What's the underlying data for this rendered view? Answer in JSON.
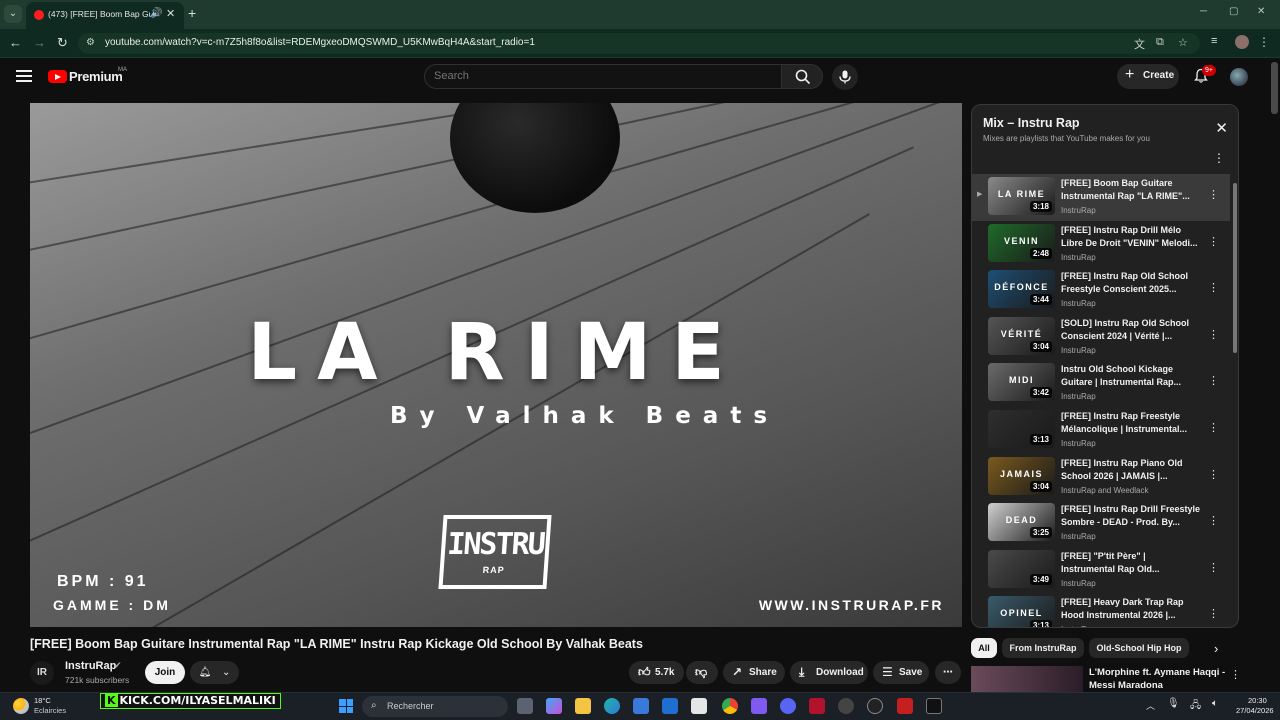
{
  "browser": {
    "tab_title": "(473) [FREE] Boom Bap Guit",
    "url": "youtube.com/watch?v=c-m7Z5h8f8o&list=RDEMgxeoDMQSWMD_U5KMwBqH4A&start_radio=1"
  },
  "header": {
    "brand": "Premium",
    "country": "MA",
    "search_placeholder": "Search",
    "create_label": "Create",
    "notification_count": "9+"
  },
  "video": {
    "overlay_title": "LA RIME",
    "overlay_subtitle": "By Valhak Beats",
    "logo_text": "INSTRU",
    "logo_sub": "RAP",
    "bpm": "BPM : 91",
    "gamme": "GAMME : DM",
    "website": "WWW.INSTRURAP.FR",
    "title": "[FREE] Boom Bap Guitare Instrumental Rap \"LA RIME\" Instru Rap Kickage Old School By Valhak Beats"
  },
  "channel": {
    "avatar_text": "IR",
    "name": "InstruRap",
    "subscribers": "721k subscribers",
    "join_label": "Join"
  },
  "actions": {
    "likes": "5.7k",
    "share": "Share",
    "download": "Download",
    "save": "Save"
  },
  "playlist": {
    "title": "Mix – Instru Rap",
    "subtitle": "Mixes are playlists that YouTube makes for you",
    "items": [
      {
        "title": "[FREE] Boom Bap Guitare Instrumental Rap \"LA RIME\"...",
        "channel": "InstruRap",
        "duration": "3:18",
        "thumb_text": "LA RIME",
        "thumb_color": "#8a8a8a",
        "active": true
      },
      {
        "title": "[FREE] Instru Rap Drill Mélo Libre De Droit \"VENIN\" Melodi...",
        "channel": "InstruRap",
        "duration": "2:48",
        "thumb_text": "VENIN",
        "thumb_color": "#1f6b2a"
      },
      {
        "title": "[FREE] Instru Rap Old School Freestyle Conscient 2025...",
        "channel": "InstruRap",
        "duration": "3:44",
        "thumb_text": "DÉFONCE",
        "thumb_color": "#1e4f74"
      },
      {
        "title": "[SOLD] Instru Rap Old School Conscient 2024 | Vérité |...",
        "channel": "InstruRap",
        "duration": "3:04",
        "thumb_text": "VÉRITÉ",
        "thumb_color": "#555555"
      },
      {
        "title": "Instru Old School Kickage Guitare | Instrumental Rap...",
        "channel": "InstruRap",
        "duration": "3:42",
        "thumb_text": "MIDI",
        "thumb_color": "#6b6b6b"
      },
      {
        "title": "[FREE] Instru Rap Freestyle Mélancolique | Instrumental...",
        "channel": "InstruRap",
        "duration": "3:13",
        "thumb_text": "",
        "thumb_color": "#2e2e2e"
      },
      {
        "title": "[FREE] Instru Rap Piano Old School 2026 | JAMAIS |...",
        "channel": "InstruRap and Weedlack",
        "duration": "3:04",
        "thumb_text": "JAMAIS",
        "thumb_color": "#7a5a1e"
      },
      {
        "title": "[FREE] Instru Rap Drill Freestyle Sombre - DEAD - Prod. By...",
        "channel": "InstruRap",
        "duration": "3:25",
        "thumb_text": "DEAD",
        "thumb_color": "#d0d0d0"
      },
      {
        "title": "[FREE] \"P'tit Père\" | Instrumental Rap Old...",
        "channel": "InstruRap",
        "duration": "3:49",
        "thumb_text": "",
        "thumb_color": "#4a4a4a"
      },
      {
        "title": "[FREE] Heavy Dark Trap Rap Hood Instrumental 2026 |...",
        "channel": "InstruRap",
        "duration": "3:13",
        "thumb_text": "OPINEL",
        "thumb_color": "#3a5a6a"
      }
    ]
  },
  "chips": [
    "All",
    "From InstruRap",
    "Old-School Hip Hop"
  ],
  "recommendation": {
    "title": "L'Morphine ft. Aymane Haqqi - Messi Maradona"
  },
  "taskbar": {
    "weather_temp": "18°C",
    "weather_desc": "Eclaircies",
    "kick_url": "KICK.COM/ILYASELMALIKI",
    "search_label": "Rechercher",
    "time": "20:30",
    "date": "27/04/2026"
  }
}
